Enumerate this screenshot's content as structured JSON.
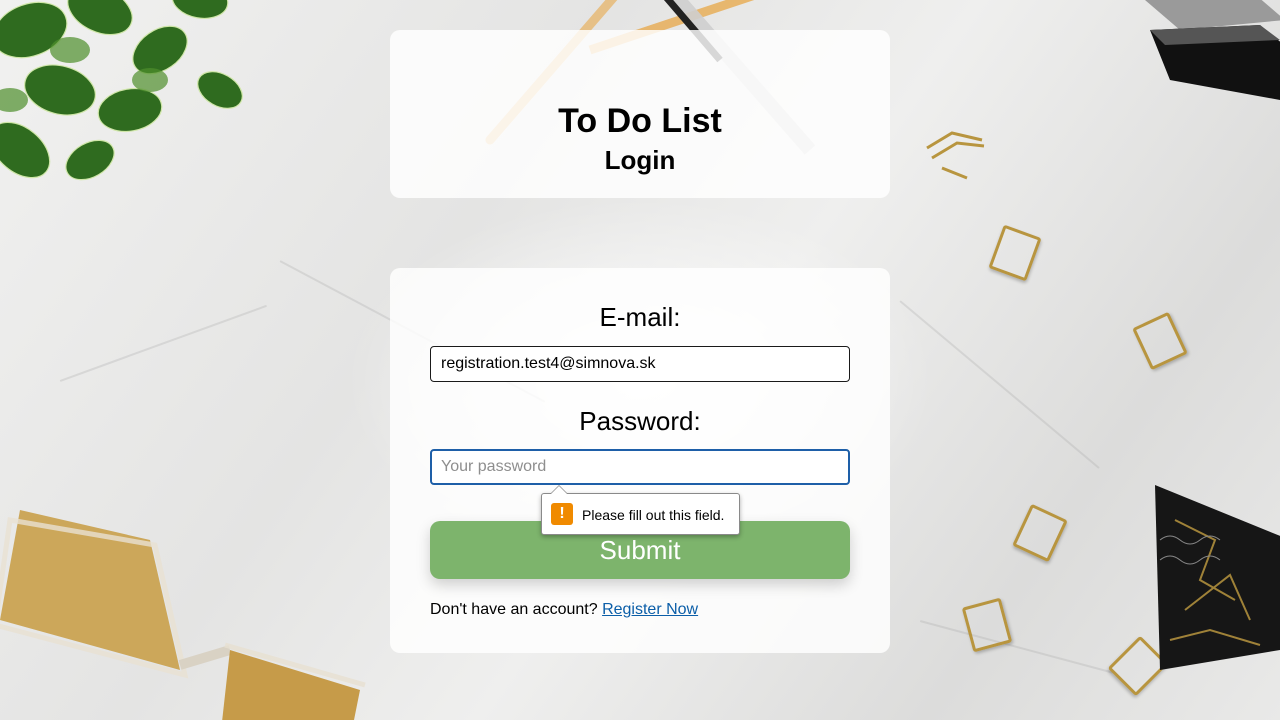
{
  "header": {
    "app_title": "To Do List",
    "page_subtitle": "Login"
  },
  "form": {
    "email_label": "E-mail:",
    "email_value": "registration.test4@simnova.sk",
    "password_label": "Password:",
    "password_value": "",
    "password_placeholder": "Your password",
    "submit_label": "Submit",
    "register_prompt": "Don't have an account?",
    "register_link": "Register Now"
  },
  "validation": {
    "message": "Please fill out this field.",
    "icon": "warning-icon"
  },
  "colors": {
    "submit_button": "#7db46c",
    "focus_border": "#1e5fa8",
    "link": "#0b5ea8",
    "warning": "#f08a00"
  }
}
